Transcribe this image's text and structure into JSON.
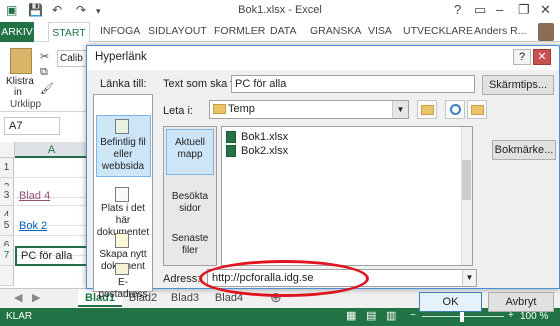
{
  "window": {
    "title": "Bok1.xlsx - Excel",
    "user": "Anders R..."
  },
  "ribbon_tabs": [
    "ARKIV",
    "START",
    "INFOGA",
    "SIDLAYOUT",
    "FORMLER",
    "DATA",
    "GRANSKA",
    "VISA",
    "UTVECKLARE"
  ],
  "ribbon": {
    "paste_label": "Klistra",
    "paste_label2": "in",
    "clipboard_group": "Urklipp",
    "font_name": "Calib"
  },
  "namebox": "A7",
  "grid": {
    "column": "A",
    "rows": [
      {
        "num": "1",
        "value": ""
      },
      {
        "num": "2",
        "value": ""
      },
      {
        "num": "3",
        "value": "Blad 4"
      },
      {
        "num": "4",
        "value": ""
      },
      {
        "num": "5",
        "value": "Bok 2"
      },
      {
        "num": "6",
        "value": ""
      },
      {
        "num": "7",
        "value": "PC för alla"
      }
    ]
  },
  "sheets": [
    "Blad1",
    "Blad2",
    "Blad3",
    "Blad4"
  ],
  "status": {
    "ready": "KLAR",
    "zoom": "100 %"
  },
  "dialog": {
    "title": "Hyperlänk",
    "link_to_label": "Länka till:",
    "link_to_items": [
      "Befintlig fil eller webbsida",
      "Plats i det här dokumentet",
      "Skapa nytt dokument",
      "E-postadress"
    ],
    "text_label": "Text som ska visas:",
    "text_value": "PC för alla",
    "screentip": "Skärmtips...",
    "look_in_label": "Leta i:",
    "look_in_value": "Temp",
    "look_folders": [
      "Aktuell mapp",
      "Besökta sidor",
      "Senaste filer"
    ],
    "files": [
      "Bok1.xlsx",
      "Bok2.xlsx"
    ],
    "bookmark": "Bokmärke...",
    "address_label": "Adress:",
    "address_value": "http://pcforalla.idg.se",
    "ok": "OK",
    "cancel": "Avbryt"
  }
}
